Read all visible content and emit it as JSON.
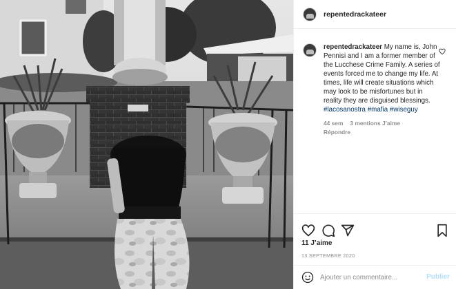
{
  "post": {
    "username": "repentedrackateer",
    "caption": {
      "username": "repentedrackateer",
      "text": "My name is, John Pennisi and I am a former member of the Lucchese Crime Family. A series of events forced me to change my life. At times, life will create situations which may look to be misfortunes but in reality they are disguised blessings.",
      "hashtags": [
        "#lacosanostra",
        "#mafia",
        "#wiseguy"
      ]
    },
    "comment_meta": {
      "age": "44 sem",
      "likes": "3 mentions J’aime",
      "reply": "Répondre"
    },
    "likes": "11 J’aime",
    "date": "13 SEPTEMBRE 2020",
    "comment": {
      "placeholder": "Ajouter un commentaire...",
      "publish": "Publier"
    }
  },
  "icons": {
    "like": "heart-icon",
    "comment": "comment-icon",
    "share": "share-icon",
    "save": "bookmark-icon",
    "emoji": "emoji-icon"
  },
  "colors": {
    "hashtag": "#00376b",
    "muted": "#8e8e8e",
    "publish_disabled": "#b2dffc",
    "text": "#262626"
  }
}
